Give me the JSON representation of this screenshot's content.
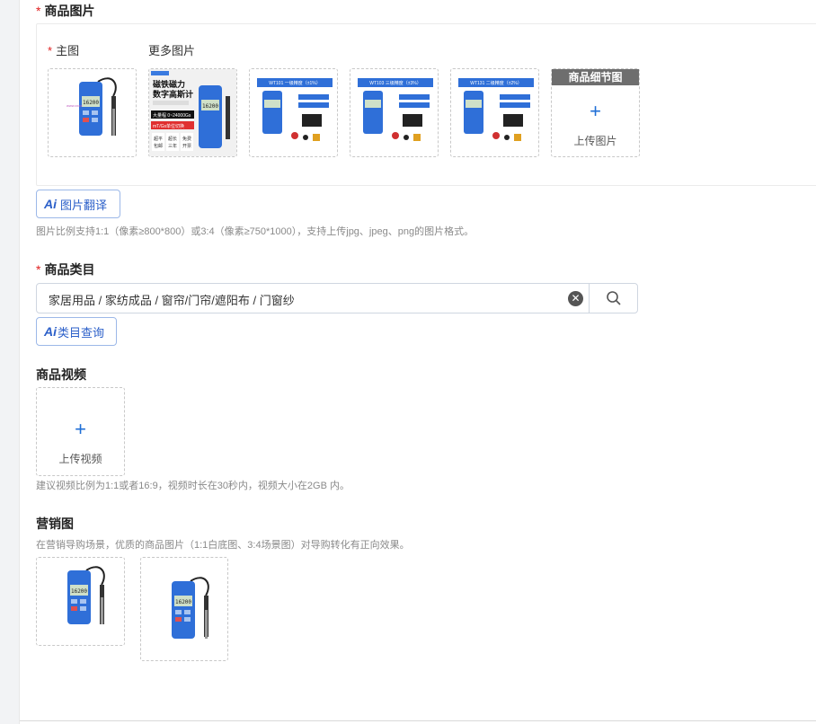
{
  "product_images": {
    "title": "商品图片",
    "main_label": "主图",
    "more_label": "更多图片",
    "thumb2_text": {
      "line1": "磁铁磁力",
      "line2": "数字高斯计",
      "line3": "大量程 0~24000Gs",
      "line4": "mT/Gs单位切换",
      "tags": [
        "超平",
        "超长",
        "免费"
      ],
      "tags2": [
        "包邮",
        "三年",
        "开票"
      ]
    },
    "thumb3_text": "WT101 一级精度（±1%）",
    "thumb4_text": "WT103 三级精度（±3%）",
    "thumb5_text": "WT131 二级精度（±2%）",
    "detail_banner": "商品细节图",
    "upload_label": "上传图片",
    "upload_icon": "plus-icon",
    "translate_label": "图片翻译",
    "ai_badge": "Ai",
    "hint": "图片比例支持1:1（像素≥800*800）或3:4（像素≥750*1000），支持上传jpg、jpeg、png的图片格式。"
  },
  "category": {
    "title": "商品类目",
    "value": "家居用品 / 家纺成品 / 窗帘/门帘/遮阳布 / 门窗纱",
    "clear_icon": "clear-icon",
    "search_icon": "search-icon",
    "query_label": "类目查询",
    "ai_badge": "Ai"
  },
  "video": {
    "title": "商品视频",
    "upload_label": "上传视频",
    "hint": "建议视频比例为1:1或者16:9，视频时长在30秒内，视频大小在2GB 内。"
  },
  "marketing": {
    "title": "营销图",
    "hint": "在营销导购场景，优质的商品图片（1:1白底图、3:4场景图）对导购转化有正向效果。"
  },
  "device_screen": "16200",
  "colors": {
    "required": "#e02020",
    "accent": "#1f6fd6",
    "device_blue": "#2f6fd8"
  }
}
